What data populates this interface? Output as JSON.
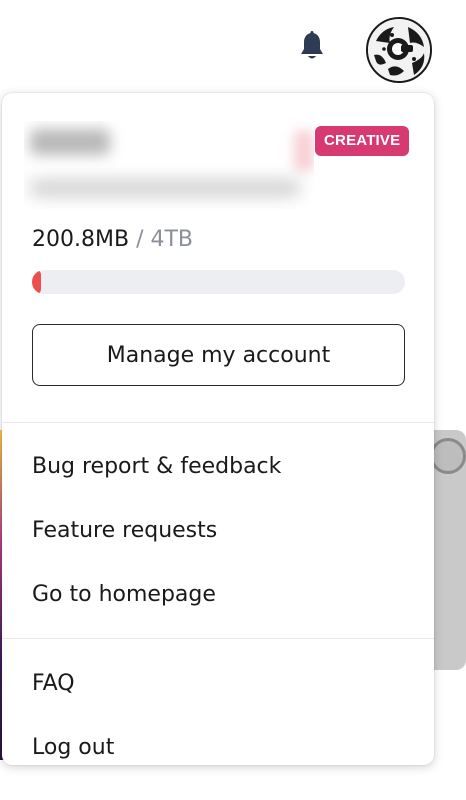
{
  "header": {
    "bell_icon": "bell-icon",
    "avatar_icon": "avatar-image"
  },
  "account": {
    "plan_badge": "CREATIVE",
    "storage_used": "200.8MB",
    "storage_separator": "/",
    "storage_total": "4TB",
    "storage_progress_fraction": 0.02,
    "manage_label": "Manage my account"
  },
  "menu": {
    "group_1": [
      {
        "label": "Bug report & feedback"
      },
      {
        "label": "Feature requests"
      },
      {
        "label": "Go to homepage"
      }
    ],
    "group_2": [
      {
        "label": "FAQ"
      },
      {
        "label": "Log out"
      }
    ]
  },
  "colors": {
    "badge": "#d63a70",
    "progress_fill": "#ef4e4e",
    "progress_track": "#eceef1",
    "bell": "#2f3a55"
  }
}
